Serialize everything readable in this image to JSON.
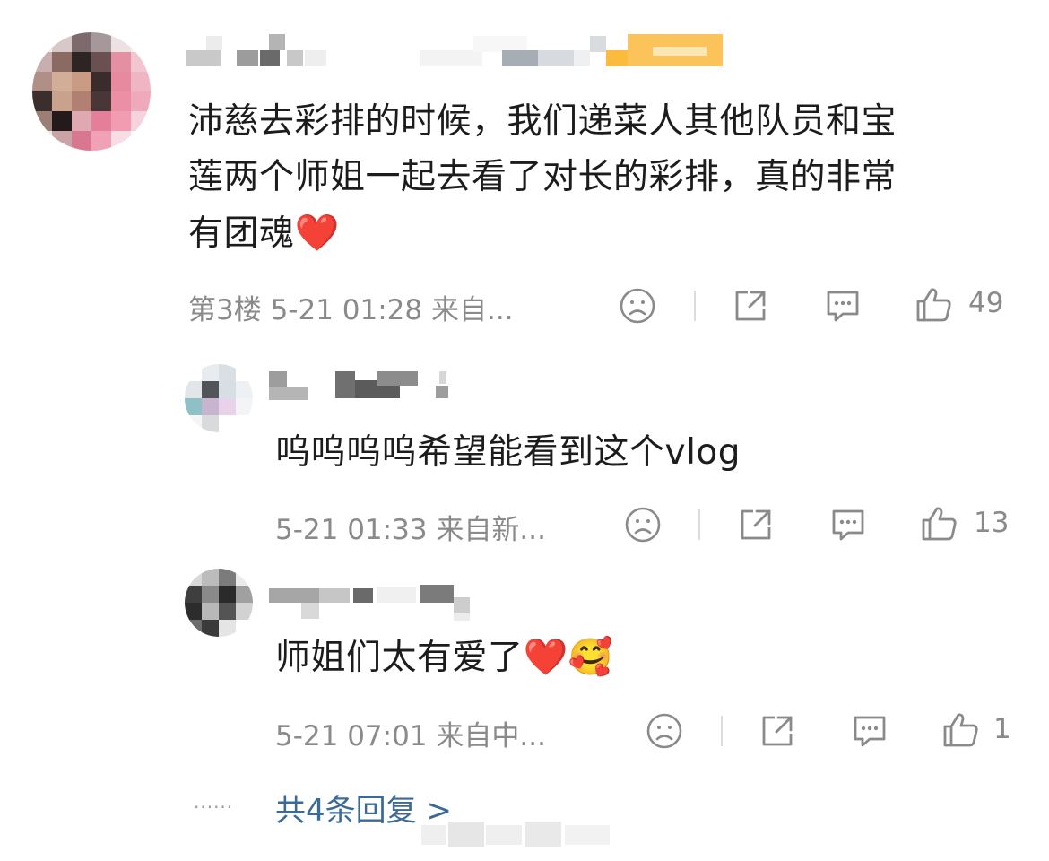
{
  "comments": [
    {
      "text": "沛慈去彩排的时候，我们递菜人其他队员和宝莲两个师姐一起去看了对长的彩排，真的非常有团魂",
      "line1": "沛慈去彩排的时候，我们递菜人其他队员和宝",
      "line2": "莲两个师姐一起去看了对长的彩排，真的非常",
      "line3": "有团魂",
      "emoji": "❤️",
      "meta": "第3楼 5-21 01:28 来自...",
      "likes": "49"
    },
    {
      "text": "呜呜呜呜希望能看到这个vlog",
      "meta": "5-21 01:33 来自新...",
      "likes": "13"
    },
    {
      "text": "师姐们太有爱了",
      "emoji1": "❤️",
      "emoji2": "🥰",
      "meta": "5-21 07:01 来自中...",
      "likes": "1"
    }
  ],
  "more_replies": "共4条回复 >",
  "dots": "......",
  "icons": [
    "sad-face-icon",
    "share-icon",
    "comment-icon",
    "thumbs-up-icon"
  ],
  "colors": {
    "text": "#1c1c1c",
    "meta": "#8a8a8a",
    "link": "#3b6a99",
    "heart": "#e0242a"
  }
}
